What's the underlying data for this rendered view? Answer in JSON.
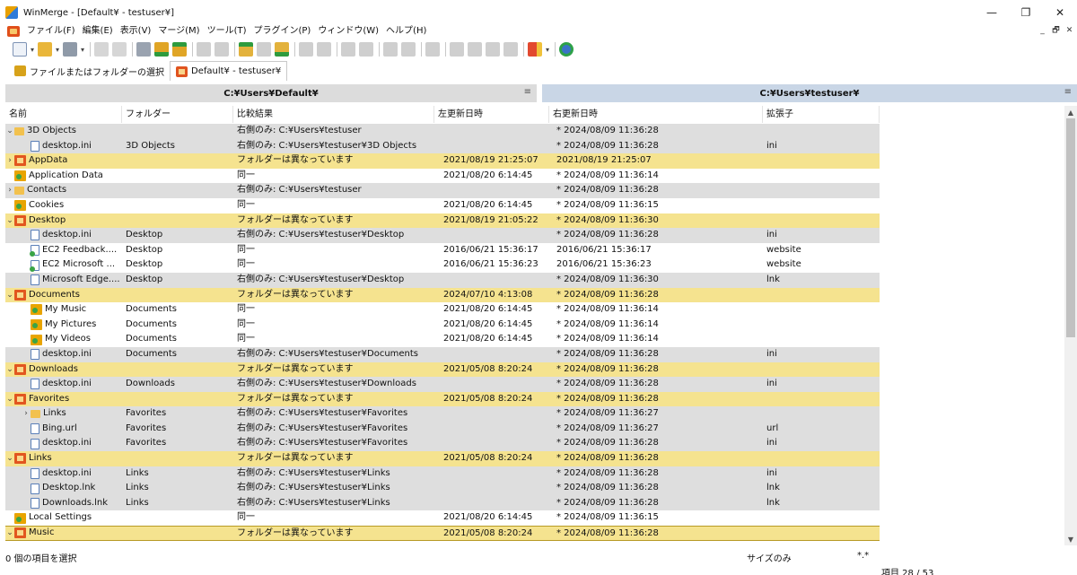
{
  "window": {
    "title": "WinMerge - [Default¥ - testuser¥]",
    "controls": {
      "minimize": "—",
      "maximize": "❐",
      "close": "✕"
    }
  },
  "menu": {
    "items": [
      "ファイル(F)",
      "編集(E)",
      "表示(V)",
      "マージ(M)",
      "ツール(T)",
      "プラグイン(P)",
      "ウィンドウ(W)",
      "ヘルプ(H)"
    ],
    "mdi": {
      "minimize": "_",
      "restore": "🗗",
      "close": "✕"
    }
  },
  "tabs": [
    {
      "label": "ファイルまたはフォルダーの選択"
    },
    {
      "label": "Default¥ - testuser¥"
    }
  ],
  "paths": {
    "left": "C:¥Users¥Default¥",
    "right": "C:¥Users¥testuser¥",
    "menu_glyph": "≡"
  },
  "columns": [
    "名前",
    "フォルダー",
    "比較結果",
    "左更新日時",
    "右更新日時",
    "拡張子"
  ],
  "rows": [
    {
      "tw": "v",
      "indent": 0,
      "icon": "folder-right",
      "name": "3D Objects",
      "folder": "",
      "result": "右側のみ: C:¥Users¥testuser",
      "left": "",
      "right": "* 2024/08/09 11:36:28",
      "ext": "",
      "bg": "gray"
    },
    {
      "tw": "",
      "indent": 1,
      "icon": "file",
      "name": "desktop.ini",
      "folder": "3D Objects",
      "result": "右側のみ: C:¥Users¥testuser¥3D Objects",
      "left": "",
      "right": "* 2024/08/09 11:36:28",
      "ext": "ini",
      "bg": "gray"
    },
    {
      "tw": ">",
      "indent": 0,
      "icon": "folder-diff",
      "name": "AppData",
      "folder": "",
      "result": "フォルダーは異なっています",
      "left": "2021/08/19 21:25:07",
      "right": "2021/08/19 21:25:07",
      "ext": "",
      "bg": "yellow"
    },
    {
      "tw": "",
      "indent": 0,
      "icon": "folder-same",
      "name": "Application Data",
      "folder": "",
      "result": "同一",
      "left": "2021/08/20 6:14:45",
      "right": "* 2024/08/09 11:36:14",
      "ext": "",
      "bg": "white"
    },
    {
      "tw": ">",
      "indent": 0,
      "icon": "folder-right",
      "name": "Contacts",
      "folder": "",
      "result": "右側のみ: C:¥Users¥testuser",
      "left": "",
      "right": "* 2024/08/09 11:36:28",
      "ext": "",
      "bg": "gray"
    },
    {
      "tw": "",
      "indent": 0,
      "icon": "folder-same",
      "name": "Cookies",
      "folder": "",
      "result": "同一",
      "left": "2021/08/20 6:14:45",
      "right": "* 2024/08/09 11:36:15",
      "ext": "",
      "bg": "white"
    },
    {
      "tw": "v",
      "indent": 0,
      "icon": "folder-diff",
      "name": "Desktop",
      "folder": "",
      "result": "フォルダーは異なっています",
      "left": "2021/08/19 21:05:22",
      "right": "* 2024/08/09 11:36:30",
      "ext": "",
      "bg": "yellow"
    },
    {
      "tw": "",
      "indent": 1,
      "icon": "file",
      "name": "desktop.ini",
      "folder": "Desktop",
      "result": "右側のみ: C:¥Users¥testuser¥Desktop",
      "left": "",
      "right": "* 2024/08/09 11:36:28",
      "ext": "ini",
      "bg": "gray"
    },
    {
      "tw": "",
      "indent": 1,
      "icon": "file-same",
      "name": "EC2 Feedback....",
      "folder": "Desktop",
      "result": "同一",
      "left": "2016/06/21 15:36:17",
      "right": "2016/06/21 15:36:17",
      "ext": "website",
      "bg": "white"
    },
    {
      "tw": "",
      "indent": 1,
      "icon": "file-same",
      "name": "EC2 Microsoft ...",
      "folder": "Desktop",
      "result": "同一",
      "left": "2016/06/21 15:36:23",
      "right": "2016/06/21 15:36:23",
      "ext": "website",
      "bg": "white"
    },
    {
      "tw": "",
      "indent": 1,
      "icon": "file",
      "name": "Microsoft Edge....",
      "folder": "Desktop",
      "result": "右側のみ: C:¥Users¥testuser¥Desktop",
      "left": "",
      "right": "* 2024/08/09 11:36:30",
      "ext": "lnk",
      "bg": "gray"
    },
    {
      "tw": "v",
      "indent": 0,
      "icon": "folder-diff",
      "name": "Documents",
      "folder": "",
      "result": "フォルダーは異なっています",
      "left": "2024/07/10 4:13:08",
      "right": "* 2024/08/09 11:36:28",
      "ext": "",
      "bg": "yellow"
    },
    {
      "tw": "",
      "indent": 1,
      "icon": "folder-same",
      "name": "My Music",
      "folder": "Documents",
      "result": "同一",
      "left": "2021/08/20 6:14:45",
      "right": "* 2024/08/09 11:36:14",
      "ext": "",
      "bg": "white"
    },
    {
      "tw": "",
      "indent": 1,
      "icon": "folder-same",
      "name": "My Pictures",
      "folder": "Documents",
      "result": "同一",
      "left": "2021/08/20 6:14:45",
      "right": "* 2024/08/09 11:36:14",
      "ext": "",
      "bg": "white"
    },
    {
      "tw": "",
      "indent": 1,
      "icon": "folder-same",
      "name": "My Videos",
      "folder": "Documents",
      "result": "同一",
      "left": "2021/08/20 6:14:45",
      "right": "* 2024/08/09 11:36:14",
      "ext": "",
      "bg": "white"
    },
    {
      "tw": "",
      "indent": 1,
      "icon": "file",
      "name": "desktop.ini",
      "folder": "Documents",
      "result": "右側のみ: C:¥Users¥testuser¥Documents",
      "left": "",
      "right": "* 2024/08/09 11:36:28",
      "ext": "ini",
      "bg": "gray"
    },
    {
      "tw": "v",
      "indent": 0,
      "icon": "folder-diff",
      "name": "Downloads",
      "folder": "",
      "result": "フォルダーは異なっています",
      "left": "2021/05/08 8:20:24",
      "right": "* 2024/08/09 11:36:28",
      "ext": "",
      "bg": "yellow"
    },
    {
      "tw": "",
      "indent": 1,
      "icon": "file",
      "name": "desktop.ini",
      "folder": "Downloads",
      "result": "右側のみ: C:¥Users¥testuser¥Downloads",
      "left": "",
      "right": "* 2024/08/09 11:36:28",
      "ext": "ini",
      "bg": "gray"
    },
    {
      "tw": "v",
      "indent": 0,
      "icon": "folder-diff",
      "name": "Favorites",
      "folder": "",
      "result": "フォルダーは異なっています",
      "left": "2021/05/08 8:20:24",
      "right": "* 2024/08/09 11:36:28",
      "ext": "",
      "bg": "yellow"
    },
    {
      "tw": ">",
      "indent": 1,
      "icon": "folder-right",
      "name": "Links",
      "folder": "Favorites",
      "result": "右側のみ: C:¥Users¥testuser¥Favorites",
      "left": "",
      "right": "* 2024/08/09 11:36:27",
      "ext": "",
      "bg": "gray"
    },
    {
      "tw": "",
      "indent": 1,
      "icon": "file",
      "name": "Bing.url",
      "folder": "Favorites",
      "result": "右側のみ: C:¥Users¥testuser¥Favorites",
      "left": "",
      "right": "* 2024/08/09 11:36:27",
      "ext": "url",
      "bg": "gray"
    },
    {
      "tw": "",
      "indent": 1,
      "icon": "file",
      "name": "desktop.ini",
      "folder": "Favorites",
      "result": "右側のみ: C:¥Users¥testuser¥Favorites",
      "left": "",
      "right": "* 2024/08/09 11:36:28",
      "ext": "ini",
      "bg": "gray"
    },
    {
      "tw": "v",
      "indent": 0,
      "icon": "folder-diff",
      "name": "Links",
      "folder": "",
      "result": "フォルダーは異なっています",
      "left": "2021/05/08 8:20:24",
      "right": "* 2024/08/09 11:36:28",
      "ext": "",
      "bg": "yellow"
    },
    {
      "tw": "",
      "indent": 1,
      "icon": "file",
      "name": "desktop.ini",
      "folder": "Links",
      "result": "右側のみ: C:¥Users¥testuser¥Links",
      "left": "",
      "right": "* 2024/08/09 11:36:28",
      "ext": "ini",
      "bg": "gray"
    },
    {
      "tw": "",
      "indent": 1,
      "icon": "file",
      "name": "Desktop.lnk",
      "folder": "Links",
      "result": "右側のみ: C:¥Users¥testuser¥Links",
      "left": "",
      "right": "* 2024/08/09 11:36:28",
      "ext": "lnk",
      "bg": "gray"
    },
    {
      "tw": "",
      "indent": 1,
      "icon": "file",
      "name": "Downloads.lnk",
      "folder": "Links",
      "result": "右側のみ: C:¥Users¥testuser¥Links",
      "left": "",
      "right": "* 2024/08/09 11:36:28",
      "ext": "lnk",
      "bg": "gray"
    },
    {
      "tw": "",
      "indent": 0,
      "icon": "folder-same",
      "name": "Local Settings",
      "folder": "",
      "result": "同一",
      "left": "2021/08/20 6:14:45",
      "right": "* 2024/08/09 11:36:15",
      "ext": "",
      "bg": "white"
    },
    {
      "tw": "v",
      "indent": 0,
      "icon": "folder-diff",
      "name": "Music",
      "folder": "",
      "result": "フォルダーは異なっています",
      "left": "2021/05/08 8:20:24",
      "right": "* 2024/08/09 11:36:28",
      "ext": "",
      "bg": "yellow",
      "selected": true
    }
  ],
  "status": {
    "selection": "0 個の項目を選択",
    "size_mode": "サイズのみ",
    "filter": "*.*",
    "count": "項目 28 / 53"
  },
  "colors": {
    "diff_row": "#f5e38f",
    "right_only_row": "#dedede",
    "right_path_bg": "#c9d6e6",
    "left_path_bg": "#dcdcdc"
  }
}
